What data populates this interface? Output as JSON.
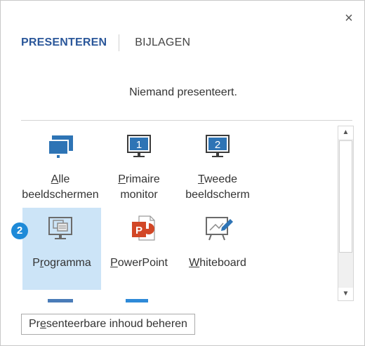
{
  "dialog": {
    "close_glyph": "×",
    "tabs": [
      {
        "label": "PRESENTEREN",
        "active": true
      },
      {
        "label": "BIJLAGEN",
        "active": false
      }
    ],
    "status": "Niemand presenteert."
  },
  "tiles": [
    {
      "id": "alle",
      "line1_accel": "A",
      "line1_rest": "lle",
      "line2": "beeldschermen",
      "icon": "all-monitors-icon"
    },
    {
      "id": "primaire",
      "line1_accel": "P",
      "line1_rest": "rimaire",
      "line2": "monitor",
      "icon": "monitor-1-icon",
      "number": "1"
    },
    {
      "id": "tweede",
      "line1_accel": "T",
      "line1_rest": "weede",
      "line2": "beeldscherm",
      "icon": "monitor-2-icon",
      "number": "2"
    },
    {
      "id": "programma",
      "pre": "P",
      "accel": "r",
      "rest": "ogramma",
      "icon": "program-window-icon",
      "selected": true
    },
    {
      "id": "powerpoint",
      "accel": "P",
      "rest": "owerPoint",
      "icon": "powerpoint-icon"
    },
    {
      "id": "whiteboard",
      "accel": "W",
      "rest": "hiteboard",
      "icon": "whiteboard-icon"
    }
  ],
  "badge": "2",
  "manage_button": {
    "pre": "Pr",
    "accel": "e",
    "rest": "senteerbare inhoud beheren"
  },
  "scrollbar": {
    "up_glyph": "▲",
    "down_glyph": "▼"
  },
  "colors": {
    "accent": "#2b579a",
    "selection": "#cce4f7",
    "badge": "#1e8ad8",
    "monitor_blue": "#2e74b5",
    "powerpoint_red": "#d24726"
  }
}
